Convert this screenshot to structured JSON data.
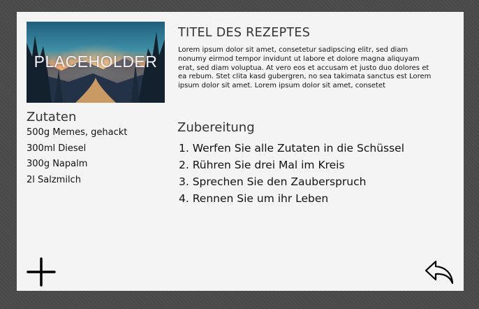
{
  "recipe": {
    "image_placeholder_text": "PLACEHOLDER",
    "title": "TITEL DES REZEPTES",
    "description": "Lorem ipsum dolor sit amet, consetetur sadipscing elitr, sed diam nonumy eirmod tempor invidunt ut labore et dolore magna aliquyam erat, sed diam voluptua. At vero eos et accusam et justo duo dolores et ea rebum. Stet clita kasd gubergren, no sea takimata sanctus est Lorem ipsum dolor sit amet. Lorem ipsum dolor sit amet, consetet"
  },
  "ingredients": {
    "heading": "Zutaten",
    "items": [
      "500g Memes, gehackt",
      "300ml Diesel",
      "300g Napalm",
      "2l Salzmilch"
    ]
  },
  "preparation": {
    "heading": "Zubereitung",
    "steps": [
      "1. Werfen Sie alle Zutaten in die Schüssel",
      "2. Rühren Sie drei Mal im Kreis",
      "3. Sprechen Sie den Zauberspruch",
      "4. Rennen Sie um ihr Leben"
    ]
  },
  "actions": {
    "add_icon": "plus-icon",
    "back_icon": "undo-arrow-icon"
  }
}
